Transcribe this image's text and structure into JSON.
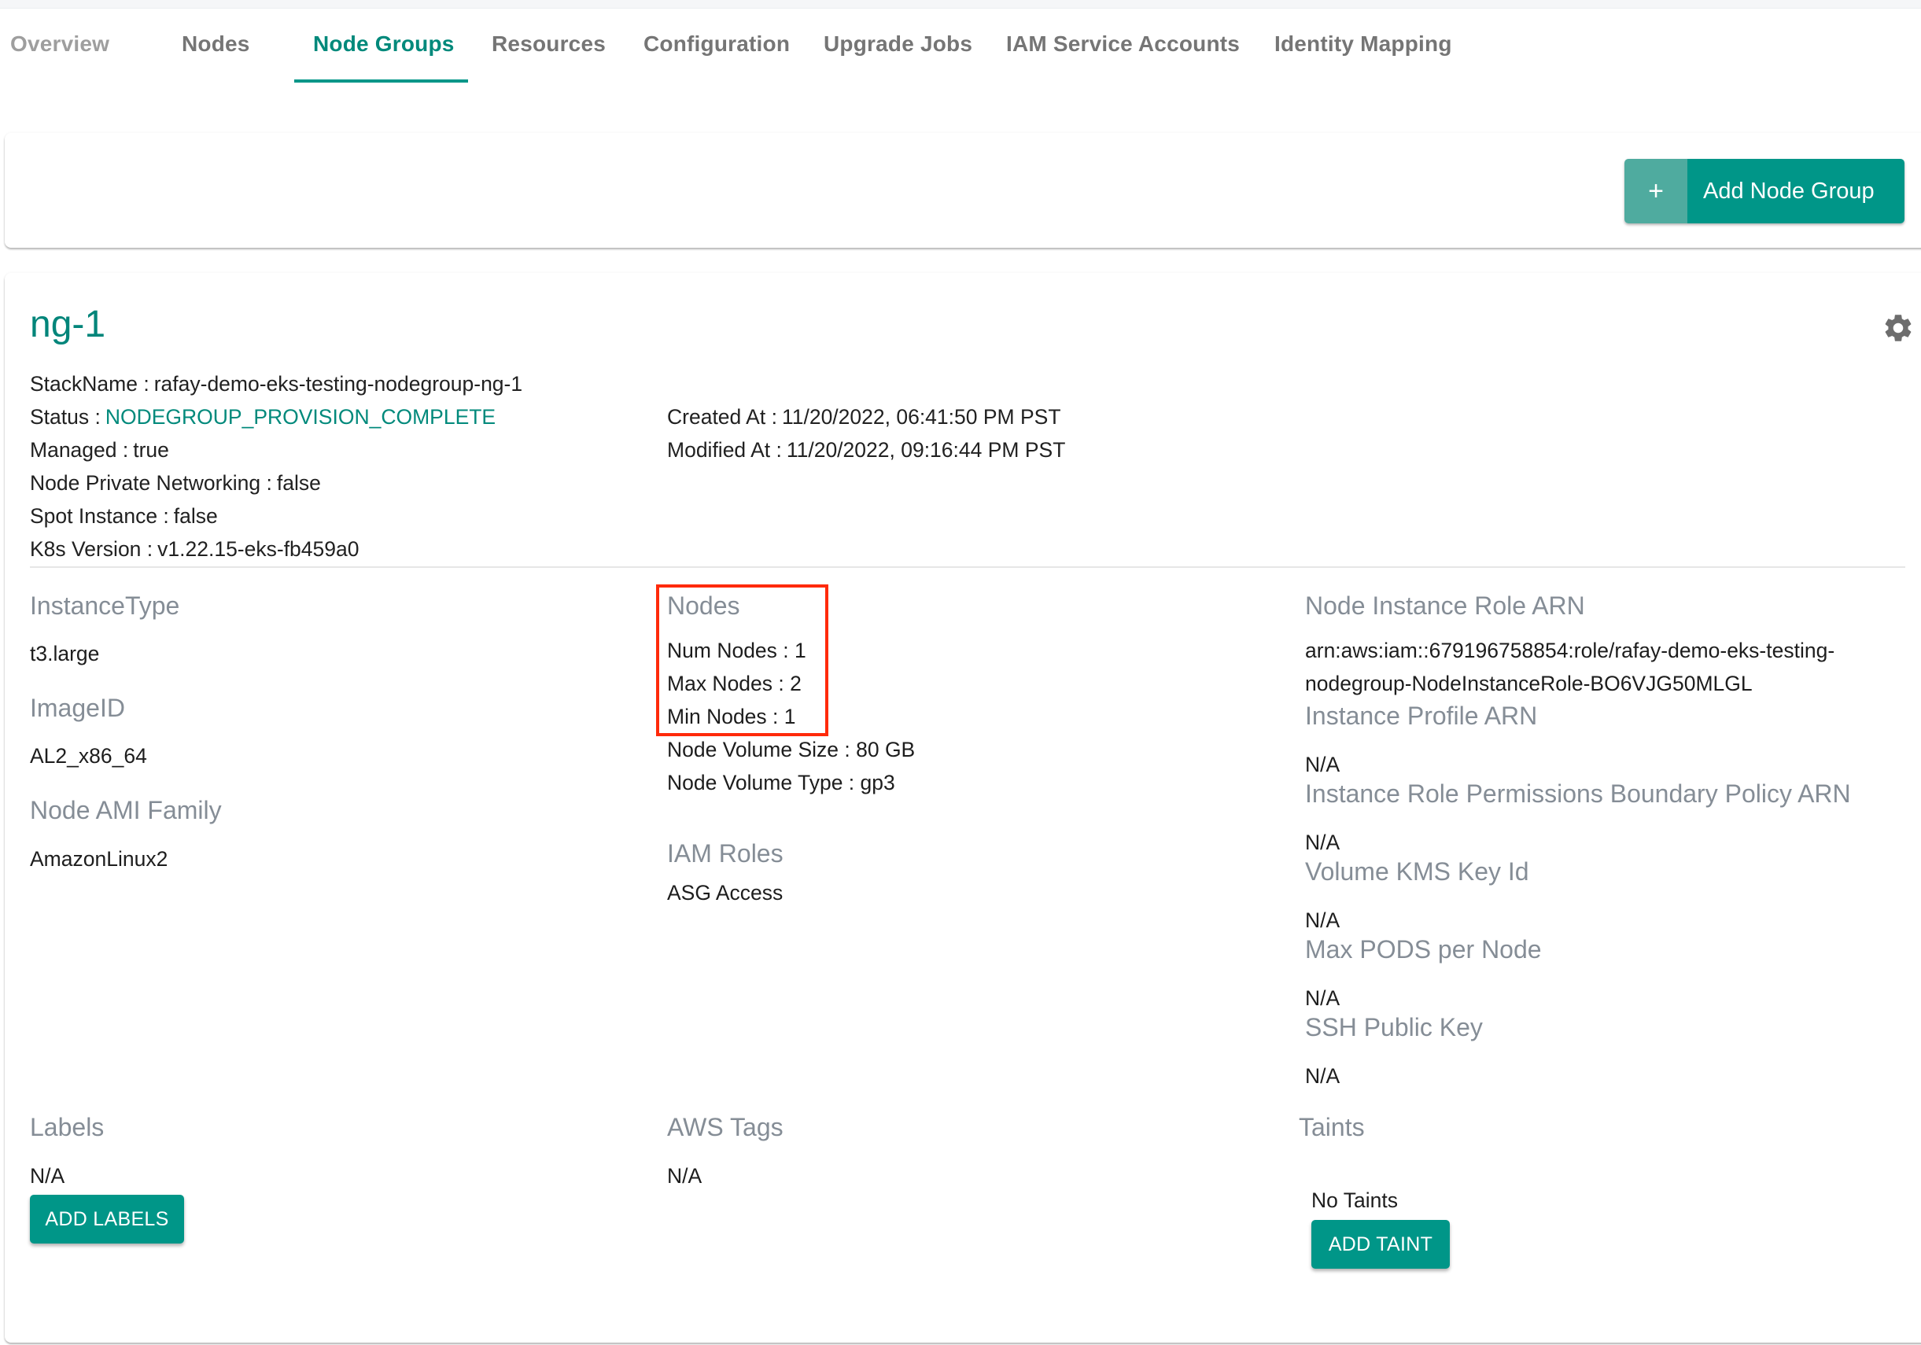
{
  "tabs": [
    {
      "label": "Overview"
    },
    {
      "label": "Nodes"
    },
    {
      "label": "Node Groups",
      "active": true
    },
    {
      "label": "Resources"
    },
    {
      "label": "Configuration"
    },
    {
      "label": "Upgrade Jobs"
    },
    {
      "label": "IAM Service Accounts"
    },
    {
      "label": "Identity Mapping"
    }
  ],
  "toolbar": {
    "add_plus": "+",
    "add_node_group_label": "Add Node Group"
  },
  "nodegroup": {
    "name": "ng-1",
    "settings_icon": "gear-icon",
    "details": {
      "stack_name_label": "StackName :",
      "stack_name": "rafay-demo-eks-testing-nodegroup-ng-1",
      "status_label": "Status :",
      "status": "NODEGROUP_PROVISION_COMPLETE",
      "managed_label": "Managed :",
      "managed": "true",
      "private_networking_label": "Node Private Networking :",
      "private_networking": "false",
      "spot_instance_label": "Spot Instance :",
      "spot_instance": "false",
      "k8s_version_label": "K8s Version :",
      "k8s_version": "v1.22.15-eks-fb459a0",
      "created_at_label": "Created At :",
      "created_at": "11/20/2022, 06:41:50 PM PST",
      "modified_at_label": "Modified At :",
      "modified_at": "11/20/2022, 09:16:44 PM PST"
    },
    "instance_type": {
      "heading": "InstanceType",
      "value": "t3.large"
    },
    "image_id": {
      "heading": "ImageID",
      "value": "AL2_x86_64"
    },
    "ami_family": {
      "heading": "Node AMI Family",
      "value": "AmazonLinux2"
    },
    "nodes": {
      "heading": "Nodes",
      "num_nodes": "Num Nodes : 1",
      "max_nodes": "Max Nodes : 2",
      "min_nodes": "Min Nodes : 1",
      "volume_size": "Node Volume Size :  80 GB",
      "volume_type": "Node Volume Type :  gp3"
    },
    "iam_roles": {
      "heading": "IAM Roles",
      "value": "ASG Access"
    },
    "node_instance_role_arn": {
      "heading": "Node Instance Role ARN",
      "value_line1": "arn:aws:iam::679196758854:role/rafay-demo-eks-testing-",
      "value_line2": "nodegroup-NodeInstanceRole-BO6VJG50MLGL"
    },
    "instance_profile_arn": {
      "heading": "Instance Profile ARN",
      "value": "N/A"
    },
    "permissions_boundary": {
      "heading": "Instance Role Permissions Boundary Policy ARN",
      "value": "N/A"
    },
    "volume_kms_key": {
      "heading": "Volume KMS Key Id",
      "value": "N/A"
    },
    "max_pods": {
      "heading": "Max PODS per Node",
      "value": "N/A"
    },
    "ssh_public_key": {
      "heading": "SSH Public Key",
      "value": "N/A"
    },
    "labels": {
      "heading": "Labels",
      "value": "N/A",
      "button": "ADD LABELS"
    },
    "aws_tags": {
      "heading": "AWS Tags",
      "value": "N/A"
    },
    "taints": {
      "heading": "Taints",
      "value": "No Taints",
      "button": "ADD TAINT"
    }
  },
  "colors": {
    "accent": "#009688",
    "accent_text": "#00897b",
    "highlight_box": "#ff2a0a",
    "heading_gray": "#858d96"
  }
}
